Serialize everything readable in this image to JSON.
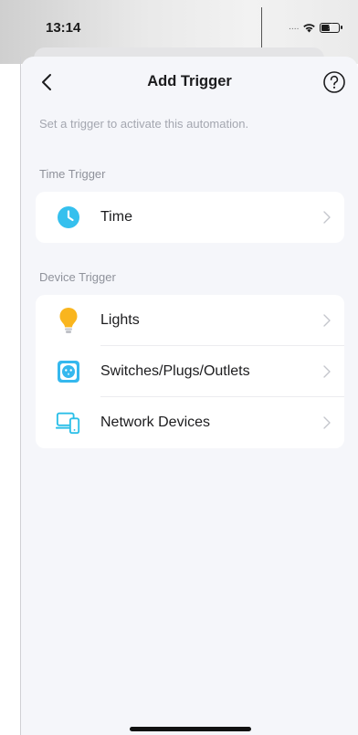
{
  "status_bar": {
    "time": "13:14",
    "signal_text": "....",
    "icons": [
      "wifi-icon",
      "battery-charging-icon"
    ]
  },
  "header": {
    "title": "Add Trigger",
    "back_icon": "chevron-left-icon",
    "help_icon": "question-circle-icon"
  },
  "subtitle": "Set a trigger to activate this automation.",
  "sections": [
    {
      "label": "Time Trigger",
      "items": [
        {
          "label": "Time",
          "icon": "clock-icon",
          "icon_color": "#35c0ee"
        }
      ]
    },
    {
      "label": "Device Trigger",
      "items": [
        {
          "label": "Lights",
          "icon": "lightbulb-icon",
          "icon_color": "#f9b51e"
        },
        {
          "label": "Switches/Plugs/Outlets",
          "icon": "smart-plug-icon",
          "icon_color": "#35b8ee"
        },
        {
          "label": "Network Devices",
          "icon": "network-devices-icon",
          "icon_color": "#2bbfe8"
        }
      ]
    }
  ]
}
